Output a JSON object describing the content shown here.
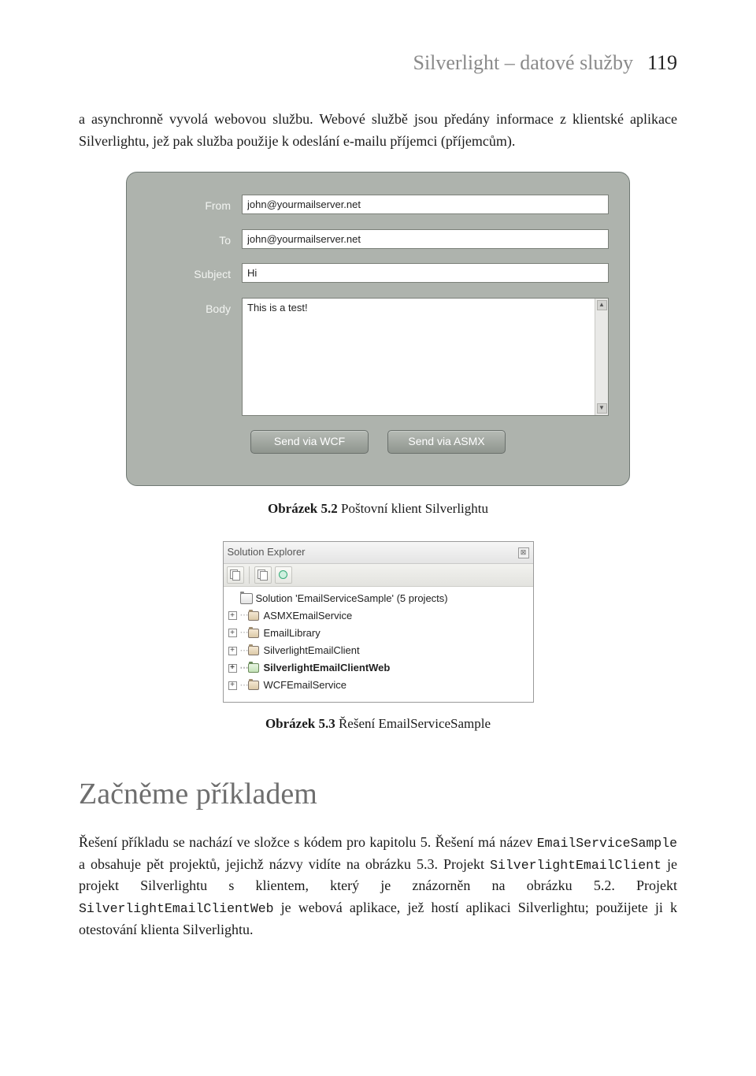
{
  "header": {
    "title": "Silverlight – datové služby",
    "page": "119"
  },
  "para1": "a asynchronně vyvolá webovou službu. Webové službě jsou předány informace z klientské aplikace Silverlightu, jež pak služba použije k odeslání e-mailu příjemci (příjemcům).",
  "figure1": {
    "labels": {
      "from": "From",
      "to": "To",
      "subject": "Subject",
      "body": "Body"
    },
    "values": {
      "from": "john@yourmailserver.net",
      "to": "john@yourmailserver.net",
      "subject": "Hi",
      "body": "This is a test!"
    },
    "buttons": {
      "wcf": "Send via WCF",
      "asmx": "Send via ASMX"
    }
  },
  "caption1_bold": "Obrázek 5.2",
  "caption1_rest": " Poštovní klient Silverlightu",
  "figure2": {
    "title": "Solution Explorer",
    "solution": "Solution 'EmailServiceSample' (5 projects)",
    "projects": [
      {
        "name": "ASMXEmailService",
        "bold": false,
        "green": false
      },
      {
        "name": "EmailLibrary",
        "bold": false,
        "green": false
      },
      {
        "name": "SilverlightEmailClient",
        "bold": false,
        "green": false
      },
      {
        "name": "SilverlightEmailClientWeb",
        "bold": true,
        "green": true
      },
      {
        "name": "WCFEmailService",
        "bold": false,
        "green": false
      }
    ]
  },
  "caption2_bold": "Obrázek 5.3",
  "caption2_rest": " Řešení EmailServiceSample",
  "heading": "Začněme příkladem",
  "para2_pre": "Řešení příkladu se nachází ve složce s kódem pro kapitolu 5. Řešení má název ",
  "para2_code1": "EmailServiceSample",
  "para2_mid1": " a obsahuje pět projektů, jejichž názvy vidíte na obrázku 5.3. Projekt ",
  "para2_code2": "SilverlightEmailClient",
  "para2_mid2": " je projekt Silverlightu s klientem, který je znázorněn na obrázku 5.2. Projekt ",
  "para2_code3": "SilverlightEmailClientWeb",
  "para2_post": " je webová aplikace, jež hostí aplikaci Silverlightu; použijete ji k otestování klienta Silverlightu."
}
